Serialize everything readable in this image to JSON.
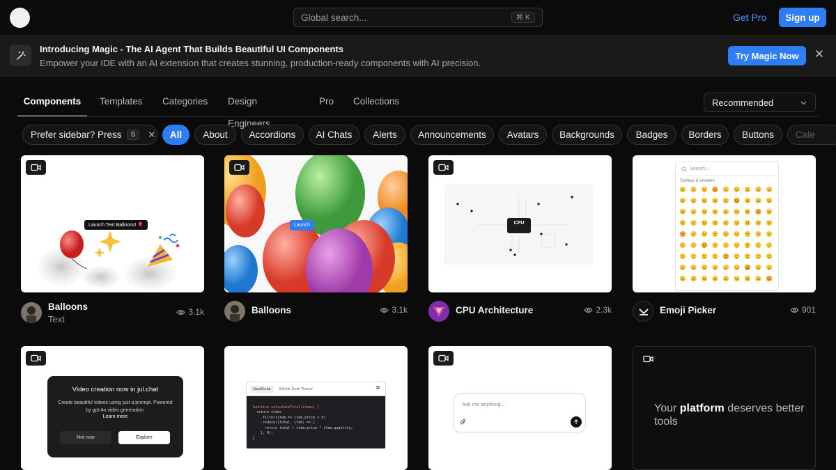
{
  "topbar": {
    "search_placeholder": "Global search...",
    "search_shortcut": "⌘ K",
    "get_pro": "Get Pro",
    "sign_up": "Sign up"
  },
  "banner": {
    "title": "Introducing Magic - The AI Agent That Builds Beautiful UI Components",
    "subtitle": "Empower your IDE with an AI extension that creates stunning, production-ready components with AI precision.",
    "cta": "Try Magic Now"
  },
  "tabs": [
    "Components",
    "Templates",
    "Categories",
    "Design Engineers",
    "Pro",
    "Collections"
  ],
  "sort": {
    "selected": "Recommended"
  },
  "filters": {
    "sidebar_hint": "Prefer sidebar? Press",
    "sidebar_key": "S",
    "pills": [
      "All",
      "About",
      "Accordions",
      "AI Chats",
      "Alerts",
      "Announcements",
      "Avatars",
      "Backgrounds",
      "Badges",
      "Borders",
      "Buttons",
      "Cale"
    ]
  },
  "cards": [
    {
      "name": "Balloons",
      "subtitle": "Text",
      "views": "3.1k",
      "preview_button": "Launch Text Balloons! 🎈"
    },
    {
      "name": "Balloons",
      "subtitle": "",
      "views": "3.1k",
      "preview_button": "Launch"
    },
    {
      "name": "CPU Architecture",
      "subtitle": "",
      "views": "2.3k",
      "preview_chip": "CPU"
    },
    {
      "name": "Emoji Picker",
      "subtitle": "",
      "views": "901",
      "search_placeholder": "Search...",
      "section": "Smileys & emotion"
    },
    {
      "dialog_title": "Video creation now in jul.chat",
      "dialog_body": "Create beautiful videos using just a prompt. Powered by gpt-4o video generation.",
      "dialog_link": "Learn more",
      "btn_secondary": "Not now",
      "btn_primary": "Explore"
    },
    {
      "tab_active": "JavaScript",
      "tab_other": "GitHub Dark Theme",
      "code": [
        "function calculateTotal(items) {",
        "  return items",
        "    .filter(item => item.price > 0)",
        "    .reduce((total, item) => {",
        "      return total + item.price * item.quantity;",
        "    }, 0);",
        "}"
      ]
    },
    {
      "input_placeholder": "Ask me anything..."
    },
    {
      "text_pre": "Your ",
      "text_bold": "platform",
      "text_post": " deserves better tools"
    }
  ]
}
